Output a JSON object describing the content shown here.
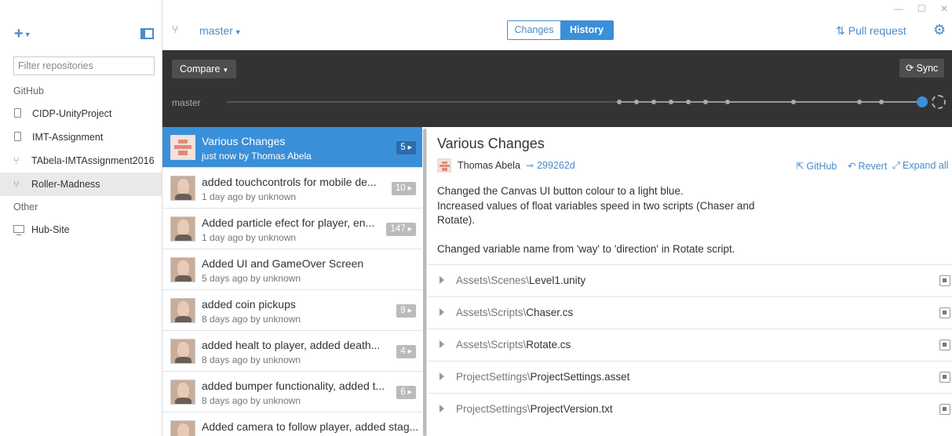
{
  "sidebar": {
    "add_label": "+",
    "filter_placeholder": "Filter repositories",
    "group_github": "GitHub",
    "group_other": "Other",
    "repos_github": [
      {
        "name": "CIDP-UnityProject",
        "icon": "repo-book-icon"
      },
      {
        "name": "IMT-Assignment",
        "icon": "repo-book-icon"
      },
      {
        "name": "TAbela-IMTAssignment2016",
        "icon": "repo-fork-icon"
      },
      {
        "name": "Roller-Madness",
        "icon": "repo-fork-icon",
        "selected": true
      }
    ],
    "repos_other": [
      {
        "name": "Hub-Site",
        "icon": "computer-icon"
      }
    ]
  },
  "toolbar": {
    "branch": "master",
    "tabs": [
      {
        "label": "Changes",
        "active": false
      },
      {
        "label": "History",
        "active": true
      }
    ],
    "pull_request": "Pull request"
  },
  "timeline": {
    "compare": "Compare",
    "sync": "Sync",
    "branch_label": "master"
  },
  "history": [
    {
      "title": "Various Changes",
      "meta": "just now by Thomas Abela",
      "badge": "5",
      "selected": true,
      "avatar": "identicon"
    },
    {
      "title": "added touchcontrols for mobile de...",
      "meta": "1 day ago by unknown",
      "badge": "10",
      "avatar": "photo"
    },
    {
      "title": "Added particle efect for player, en...",
      "meta": "1 day ago by unknown",
      "badge": "147",
      "avatar": "photo"
    },
    {
      "title": "Added UI and GameOver Screen",
      "meta": "5 days ago by unknown",
      "badge": "",
      "avatar": "photo"
    },
    {
      "title": "added coin pickups",
      "meta": "8 days ago by unknown",
      "badge": "9",
      "avatar": "photo"
    },
    {
      "title": "added healt to player, added death...",
      "meta": "8 days ago by unknown",
      "badge": "4",
      "avatar": "photo"
    },
    {
      "title": "added bumper functionality, added t...",
      "meta": "8 days ago by unknown",
      "badge": "6",
      "avatar": "photo"
    },
    {
      "title": "Added camera to follow player, added stag...",
      "meta": "",
      "badge": "",
      "avatar": "photo"
    }
  ],
  "detail": {
    "title": "Various Changes",
    "author": "Thomas Abela",
    "sha": "299262d",
    "actions": {
      "github": "GitHub",
      "revert": "Revert",
      "expand": "Expand all"
    },
    "message_lines": [
      "Changed the Canvas UI button colour to a light blue.",
      "Increased values of float variables speed in two scripts (Chaser and Rotate).",
      "Changed variable name from 'way' to 'direction' in Rotate script."
    ],
    "files": [
      {
        "dir": "Assets\\Scenes\\",
        "name": "Level1.unity"
      },
      {
        "dir": "Assets\\Scripts\\",
        "name": "Chaser.cs"
      },
      {
        "dir": "Assets\\Scripts\\",
        "name": "Rotate.cs"
      },
      {
        "dir": "ProjectSettings\\",
        "name": "ProjectSettings.asset"
      },
      {
        "dir": "ProjectSettings\\",
        "name": "ProjectVersion.txt"
      }
    ]
  },
  "colors": {
    "accent": "#3a8fd9",
    "timeline_bg": "#333333"
  }
}
